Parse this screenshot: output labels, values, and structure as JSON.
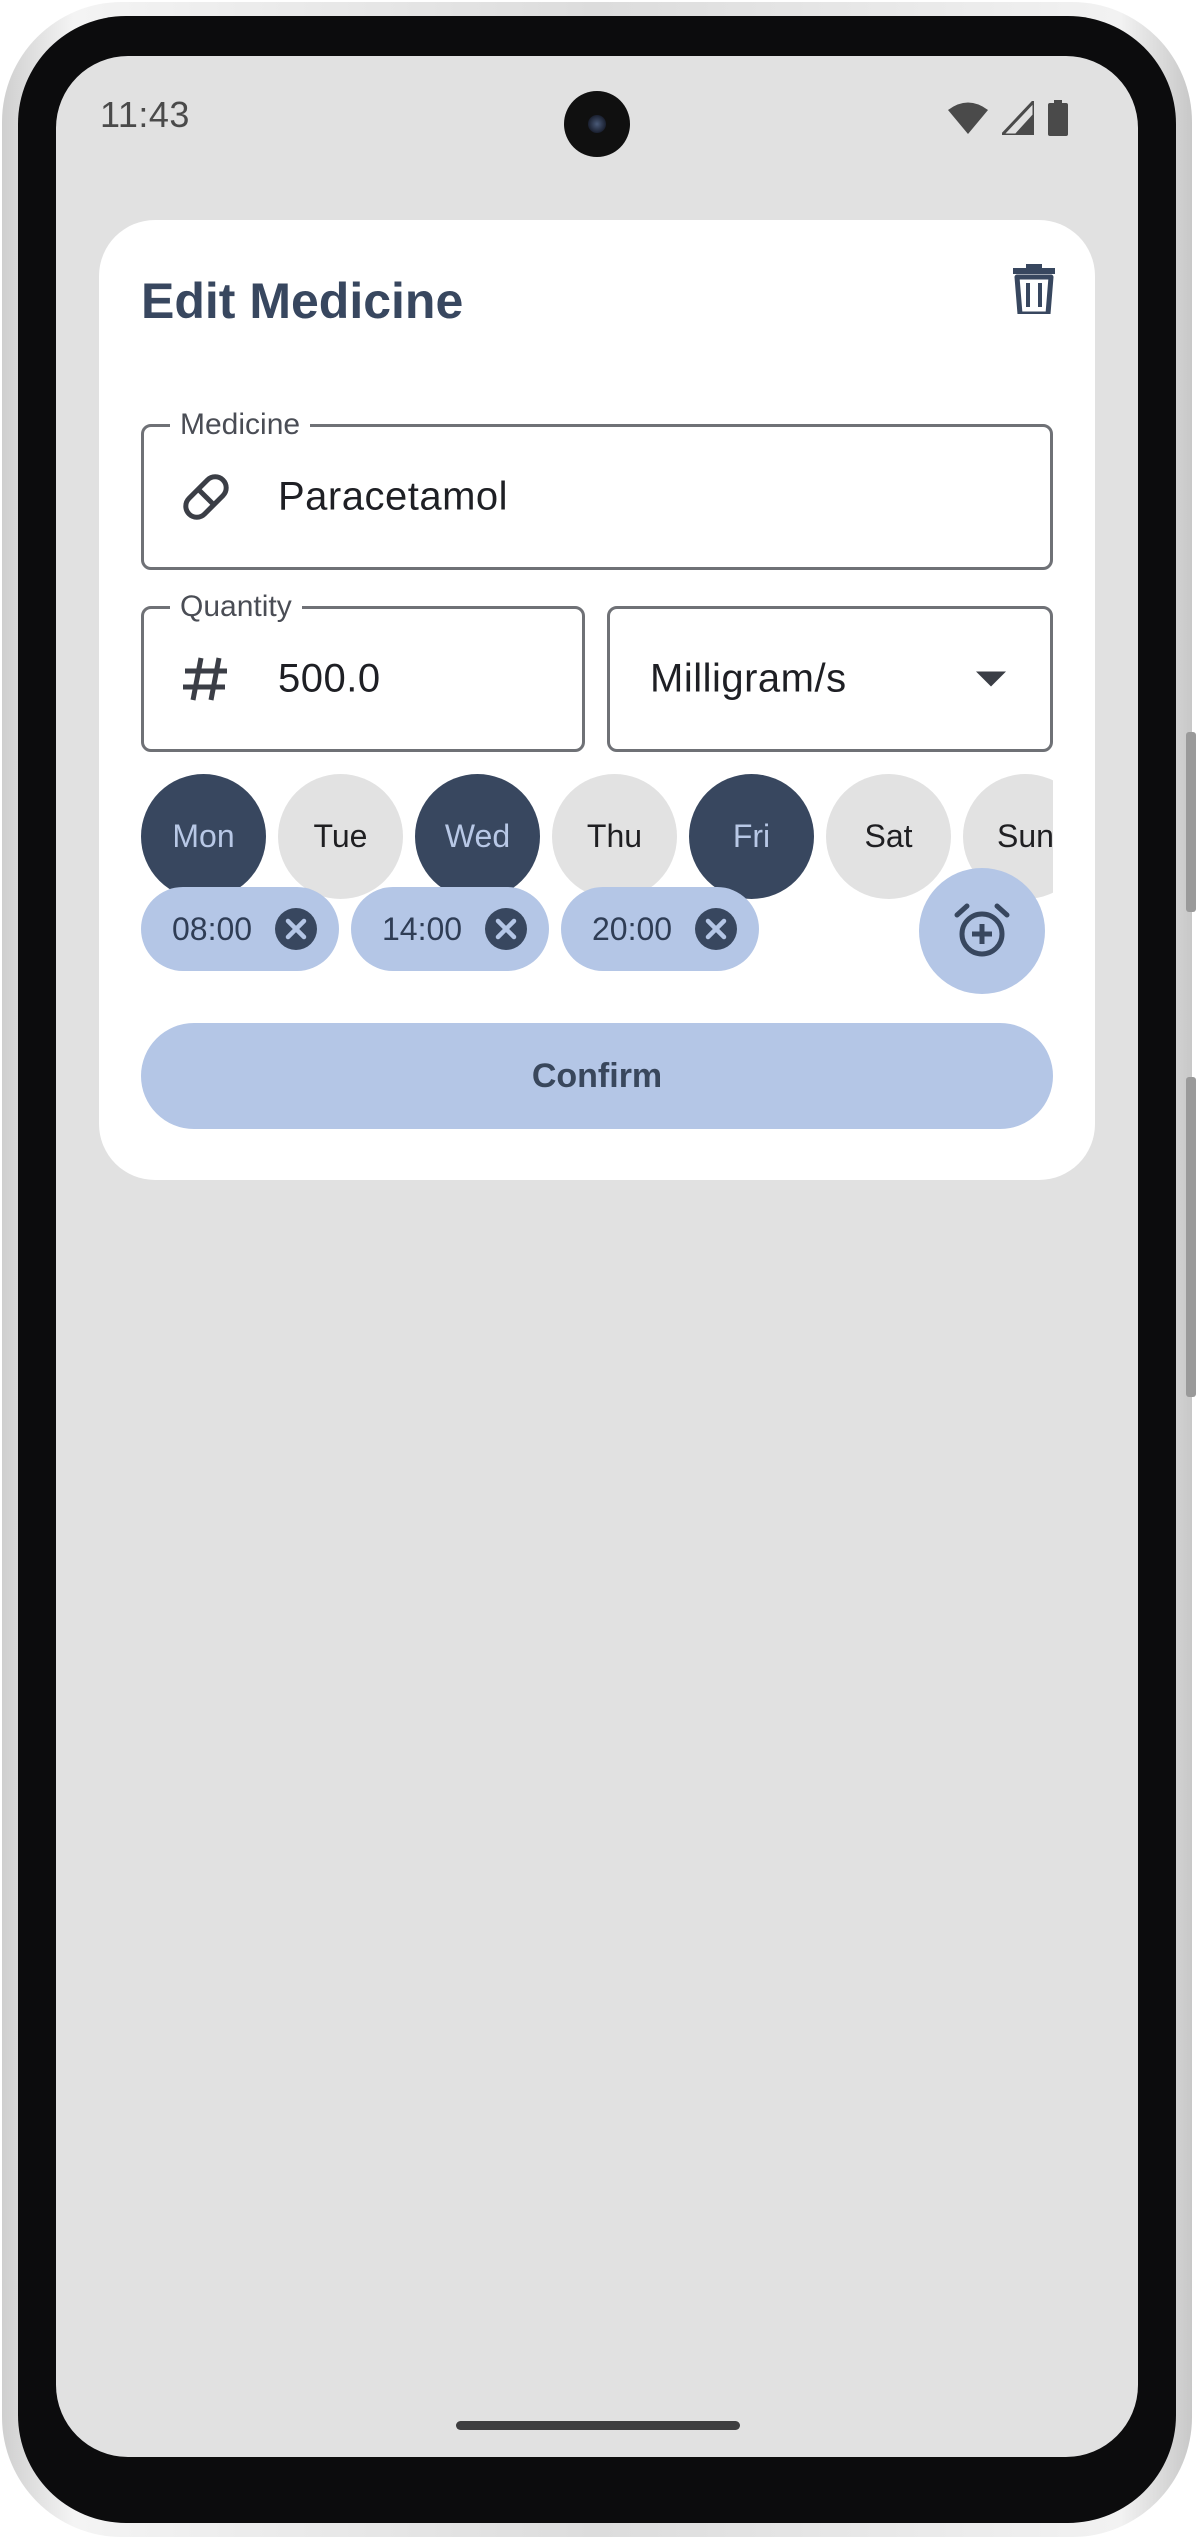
{
  "status_bar": {
    "time": "11:43",
    "icons": [
      "wifi-icon",
      "cellular-signal-icon",
      "battery-icon"
    ]
  },
  "dialog": {
    "title": "Edit Medicine",
    "delete_icon": "trash-icon",
    "medicine_field": {
      "label": "Medicine",
      "value": "Paracetamol",
      "icon": "pill-icon"
    },
    "quantity_field": {
      "label": "Quantity",
      "value": "500.0",
      "icon": "hash-icon"
    },
    "unit_field": {
      "value": "Milligram/s",
      "icon": "dropdown-arrow-icon"
    },
    "days": [
      {
        "label": "Mon",
        "selected": true
      },
      {
        "label": "Tue",
        "selected": false
      },
      {
        "label": "Wed",
        "selected": true
      },
      {
        "label": "Thu",
        "selected": false
      },
      {
        "label": "Fri",
        "selected": true
      },
      {
        "label": "Sat",
        "selected": false
      },
      {
        "label": "Sun",
        "selected": false
      }
    ],
    "times": [
      "08:00",
      "14:00",
      "20:00"
    ],
    "add_alarm_icon": "alarm-add-icon",
    "confirm_label": "Confirm"
  },
  "colors": {
    "primary_dark": "#38475f",
    "primary_light": "#b4c6e6",
    "screen_background": "#e1e1e1",
    "surface": "#ffffff"
  }
}
